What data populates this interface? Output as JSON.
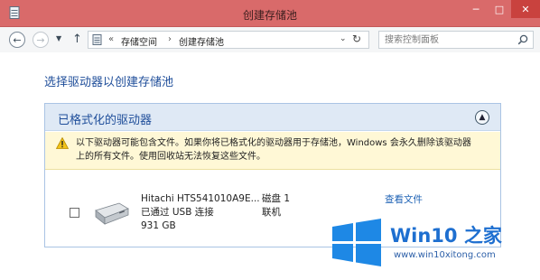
{
  "window": {
    "title": "创建存储池"
  },
  "address_bar": {
    "overflow": "«",
    "crumbs": [
      "存储空间",
      "创建存储池"
    ],
    "search_placeholder": "搜索控制面板"
  },
  "main": {
    "heading": "选择驱动器以创建存储池",
    "panel": {
      "title": "已格式化的驱动器",
      "warning_line1": "以下驱动器可能包含文件。如果你将已格式化的驱动器用于存储池，Windows 会永久删除该驱动器",
      "warning_line2": "上的所有文件。使用回收站无法恢复这些文件。",
      "drive": {
        "name": "Hitachi HTS541010A9E...",
        "connection": "已通过 USB 连接",
        "size": "931 GB",
        "disk_label": "磁盘 1",
        "status": "联机",
        "view_files": "查看文件"
      }
    }
  },
  "watermark": {
    "title": "Win10 之家",
    "url": "www.win10xitong.com"
  },
  "colors": {
    "titlebar": "#d96a6a",
    "close_button": "#c9423e",
    "heading_blue": "#1f4e9a",
    "panel_header": "#dfe9f5",
    "warning_bg": "#fff8d6",
    "link": "#1f63b5"
  },
  "icons": {
    "app": "storage-spaces-icon",
    "back": "back-arrow-icon",
    "forward": "forward-arrow-icon",
    "up": "up-arrow-icon",
    "refresh": "refresh-icon",
    "search": "search-icon",
    "collapse": "chevron-up-icon",
    "warning": "warning-icon",
    "drive": "hard-drive-icon"
  }
}
